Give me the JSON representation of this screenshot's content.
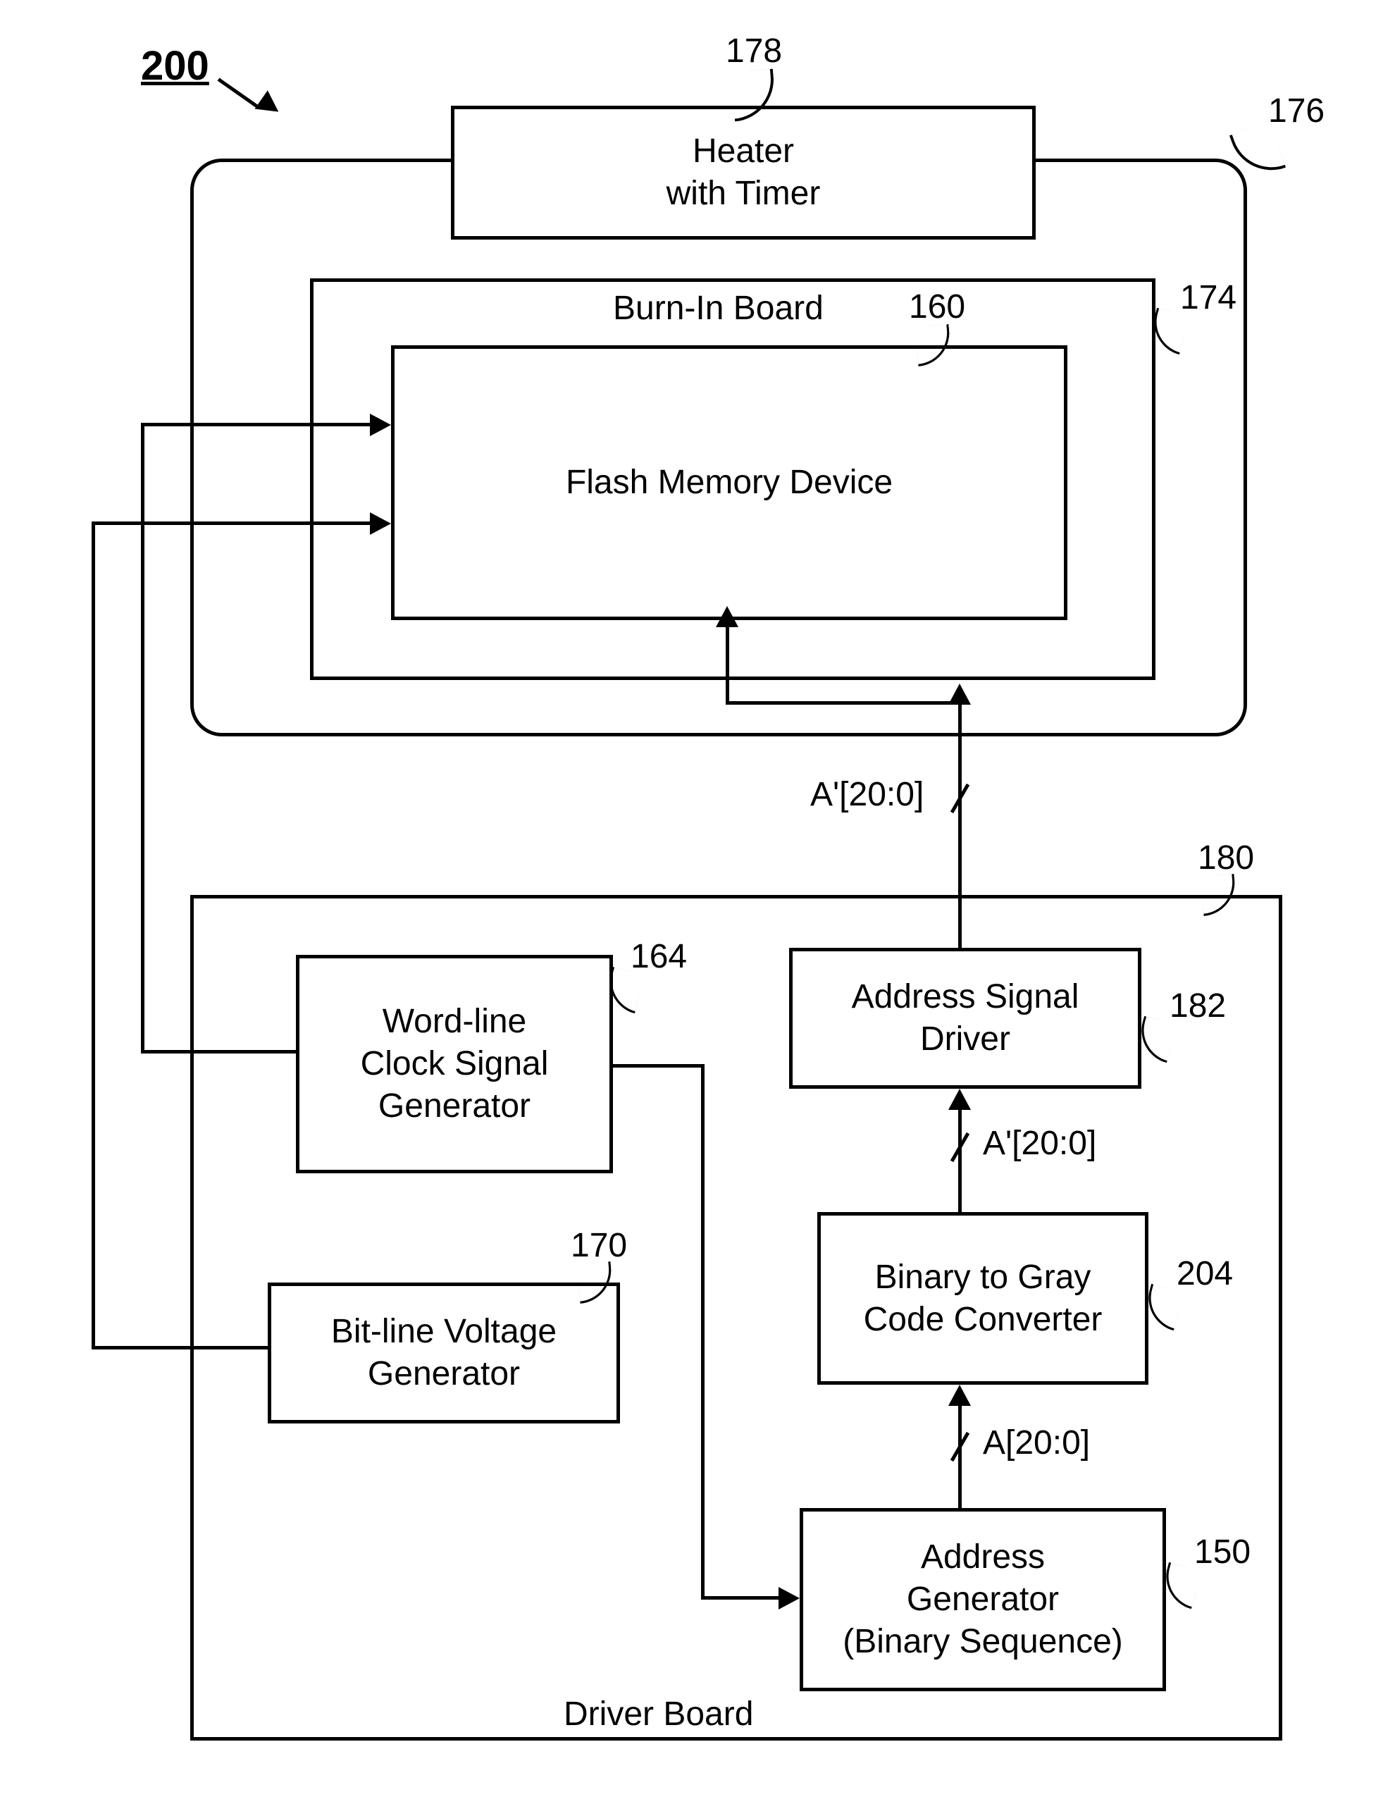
{
  "figure_ref": "200",
  "refs": {
    "heater": "178",
    "oven": "176",
    "burnin": "174",
    "flash": "160",
    "driver": "180",
    "wordline": "164",
    "bitline": "170",
    "addrdrv": "182",
    "converter": "204",
    "addrgen": "150"
  },
  "blocks": {
    "heater": "Heater\nwith Timer",
    "burnin_title": "Burn-In Board",
    "flash": "Flash Memory Device",
    "wordline": "Word-line\nClock Signal\nGenerator",
    "bitline": "Bit-line Voltage\nGenerator",
    "addrdrv": "Address Signal\nDriver",
    "converter": "Binary to Gray\nCode Converter",
    "addrgen": "Address\nGenerator\n(Binary Sequence)",
    "driver_title": "Driver Board"
  },
  "signals": {
    "bus_top": "A'[20:0]",
    "bus_mid": "A'[20:0]",
    "bus_low": "A[20:0]"
  }
}
